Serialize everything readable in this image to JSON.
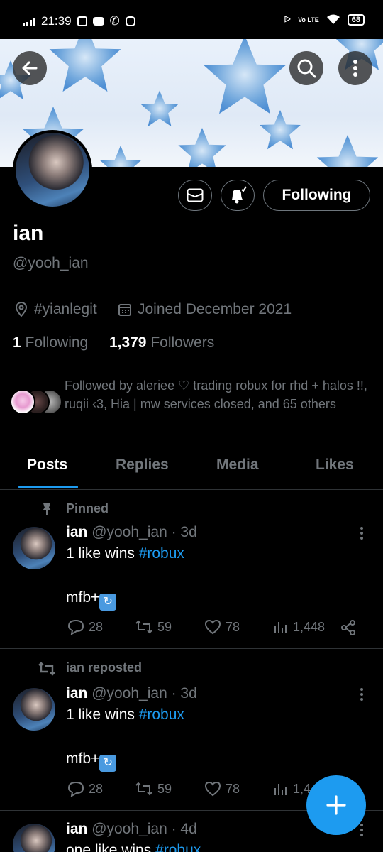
{
  "status_bar": {
    "time": "21:39",
    "battery": "68",
    "network": "Vo LTE"
  },
  "profile": {
    "name": "ian",
    "handle": "@yooh_ian",
    "location": "#yianlegit",
    "joined": "Joined December 2021",
    "following_count": "1",
    "following_label": "Following",
    "followers_count": "1,379",
    "followers_label": "Followers",
    "followed_by": "Followed by aleriee ♡ trading robux for rhd + halos !!, ruqii ‹3, Hia | mw services closed, and 65 others",
    "follow_state": "Following"
  },
  "tabs": [
    "Posts",
    "Replies",
    "Media",
    "Likes"
  ],
  "posts": [
    {
      "context": "Pinned",
      "author": "ian",
      "handle_time": "@yooh_ian · 3d",
      "text_line1": "1 like wins ",
      "hashtag": "#robux",
      "text_line2": "mfb+",
      "replies": "28",
      "reposts": "59",
      "likes": "78",
      "views": "1,448"
    },
    {
      "context": "ian reposted",
      "author": "ian",
      "handle_time": "@yooh_ian · 3d",
      "text_line1": "1 like wins ",
      "hashtag": "#robux",
      "text_line2": "mfb+",
      "replies": "28",
      "reposts": "59",
      "likes": "78",
      "views": "1,4"
    },
    {
      "author": "ian",
      "handle_time": "@yooh_ian · 4d",
      "text_line1": "one like wins ",
      "hashtag": "#robux"
    }
  ],
  "colors": {
    "accent": "#1d9bf0",
    "muted": "#71767b",
    "divider": "#2f3336"
  }
}
